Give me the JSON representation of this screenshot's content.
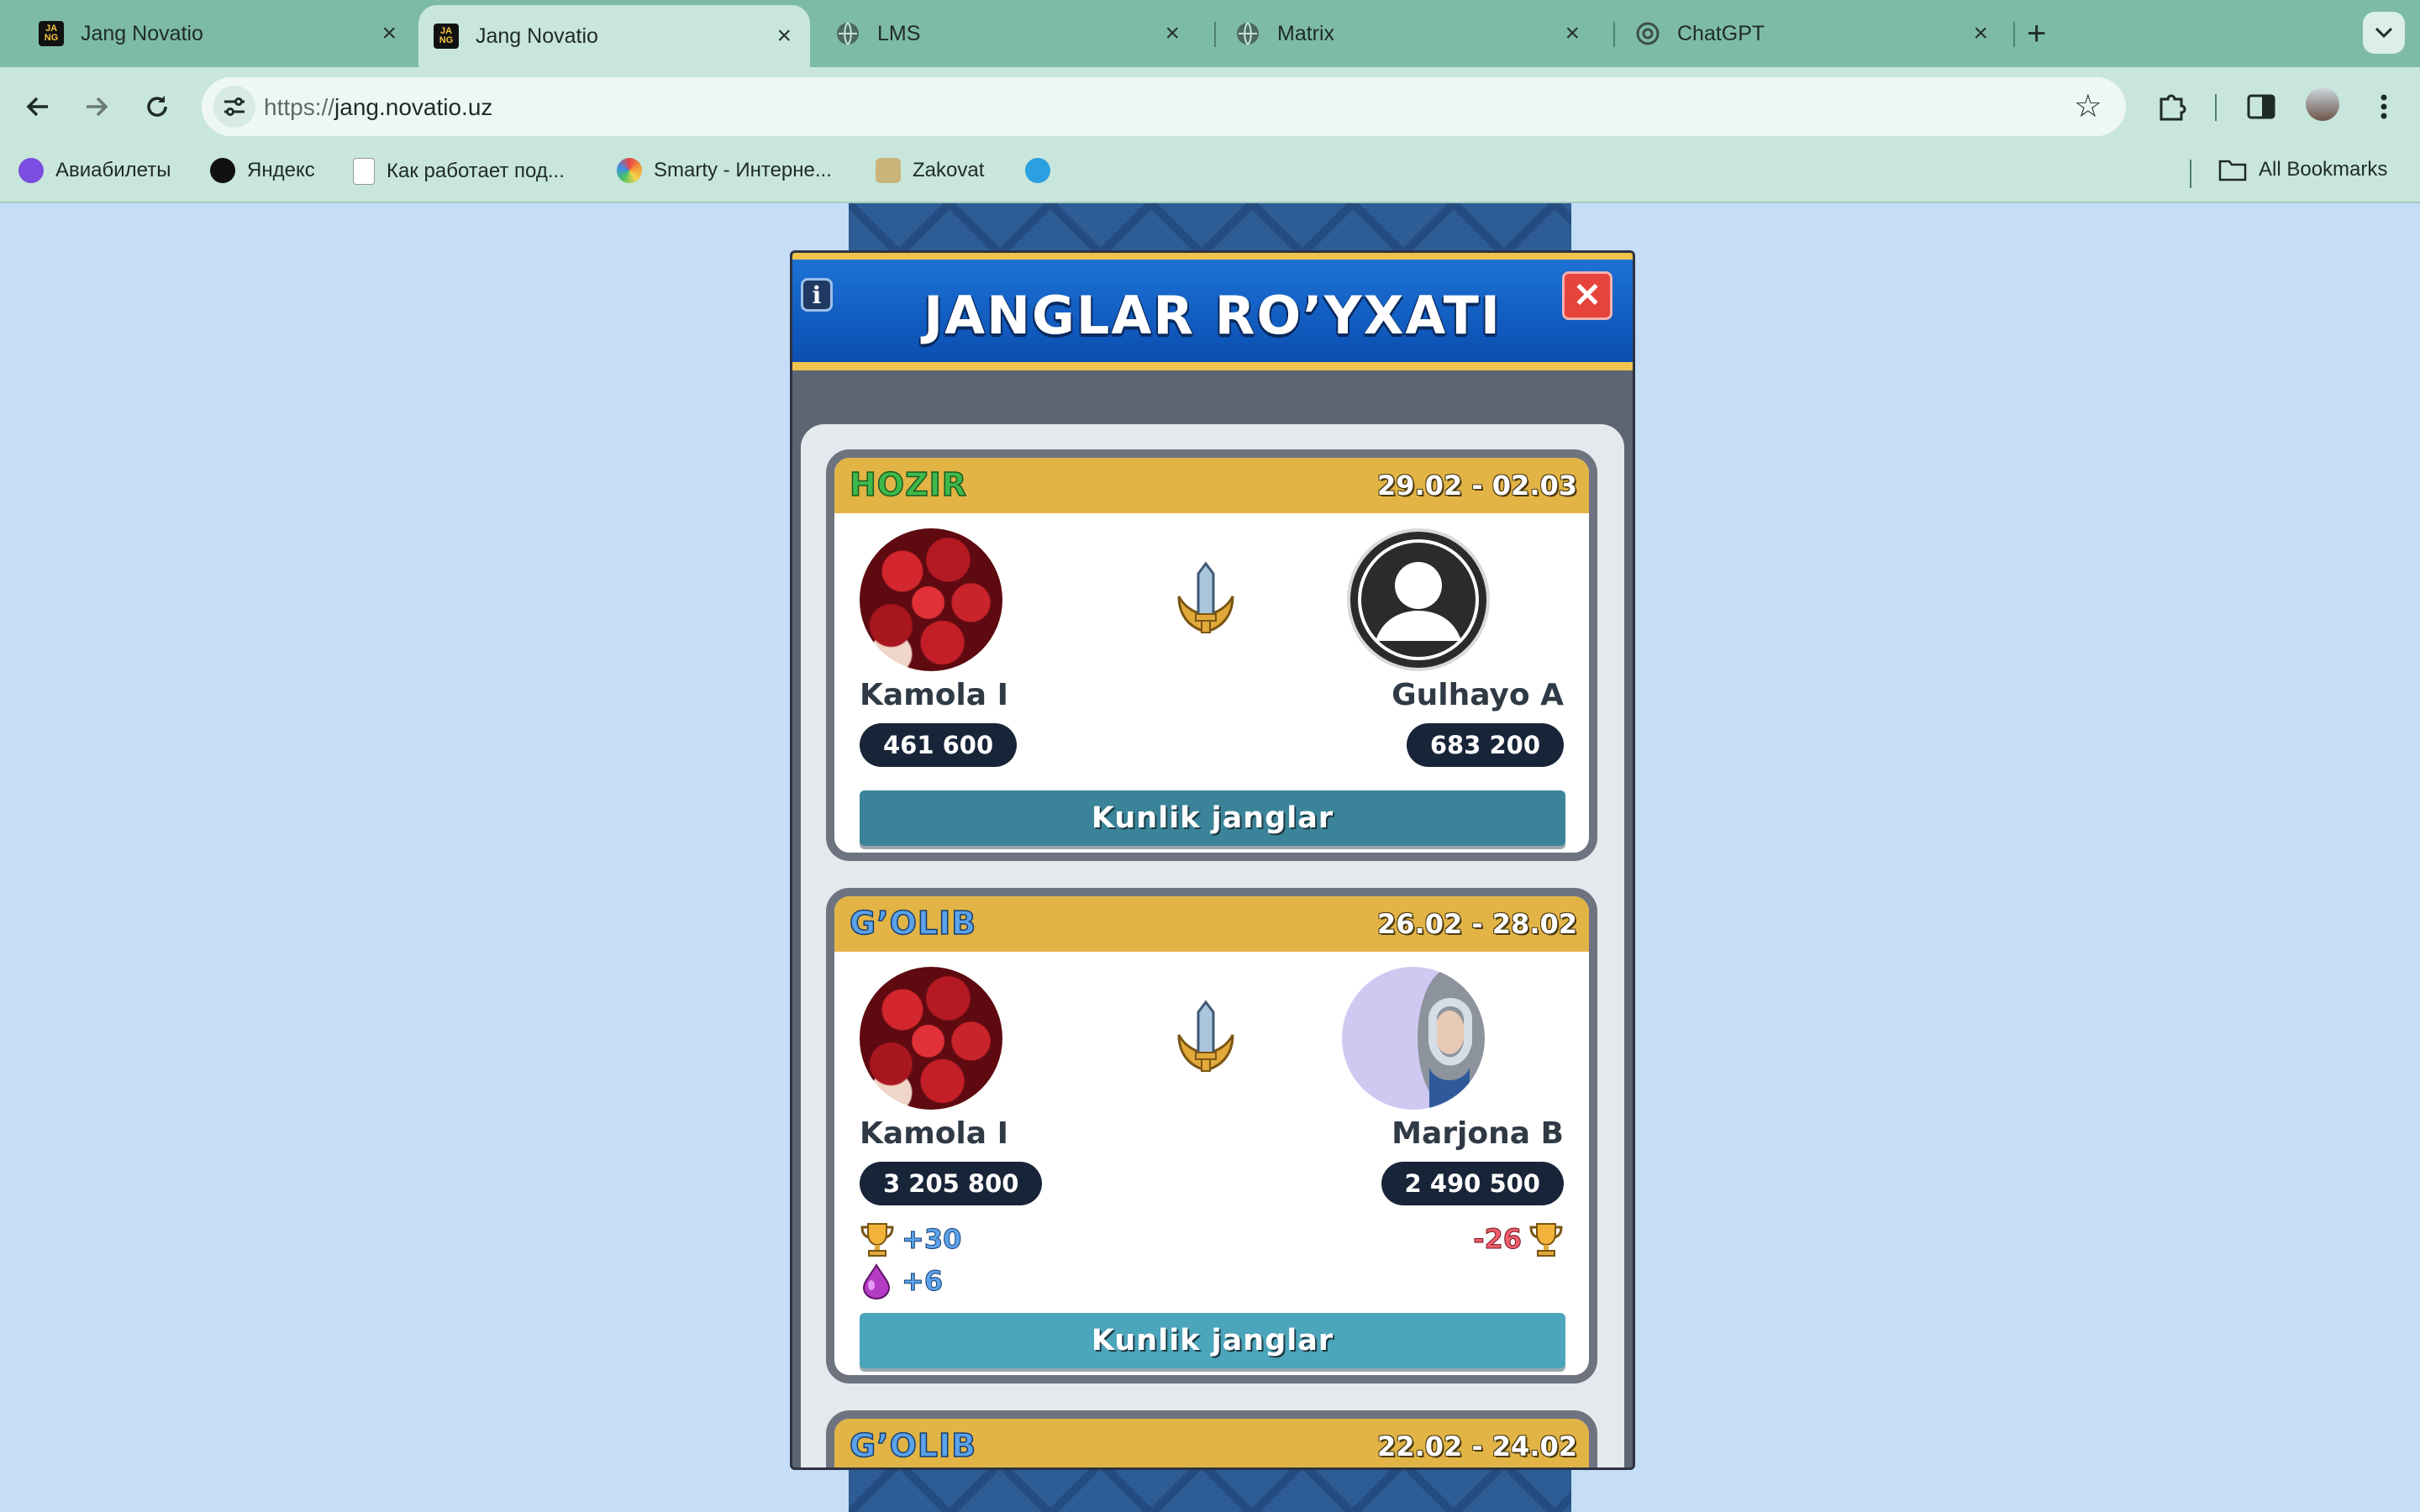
{
  "tabs": [
    {
      "title": "Jang Novatio",
      "favicon": "jn-logo",
      "active": false
    },
    {
      "title": "Jang Novatio",
      "favicon": "jn-logo",
      "active": true
    },
    {
      "title": "LMS",
      "favicon": "globe-icon",
      "active": false
    },
    {
      "title": "Matrix",
      "favicon": "globe-icon",
      "active": false
    },
    {
      "title": "ChatGPT",
      "favicon": "chatgpt-icon",
      "active": false
    }
  ],
  "favicon_text": "JA\nNG",
  "tab_close_glyph": "×",
  "new_tab_glyph": "+",
  "omnibox": {
    "scheme": "https://",
    "host": "jang.novatio.uz"
  },
  "bookmarks": [
    {
      "label": "Авиабилеты",
      "icon": "plane-icon",
      "color": "#7b4de0"
    },
    {
      "label": "Яндекс",
      "icon": "yandex-icon",
      "color": "#111111"
    },
    {
      "label": "Как работает под...",
      "icon": "doc-icon",
      "color": "#ffffff"
    },
    {
      "label": "Smarty - Интерне...",
      "icon": "rainbow-icon",
      "color": "#f29b38"
    },
    {
      "label": "Zakovat",
      "icon": "zakovat-icon",
      "color": "#c9b57a"
    },
    {
      "label": "",
      "icon": "telegram-icon",
      "color": "#2aa0e0"
    }
  ],
  "all_bookmarks_label": "All Bookmarks",
  "modal": {
    "title": "JANGLAR RO’YXATI",
    "info_glyph": "i",
    "close_glyph": "✕"
  },
  "battles": [
    {
      "status": "HOZIR",
      "dates": "29.02 - 02.03",
      "left": {
        "name": "Kamola I",
        "score": "461 600",
        "avatar": "roses"
      },
      "right": {
        "name": "Gulhayo A",
        "score": "683 200",
        "avatar": "default"
      },
      "button": "Kunlik janglar"
    },
    {
      "status": "G’OLIB",
      "dates": "26.02 - 28.02",
      "left": {
        "name": "Kamola I",
        "score": "3 205 800",
        "avatar": "roses",
        "trophy_delta": "+30",
        "elixir_delta": "+6"
      },
      "right": {
        "name": "Marjona B",
        "score": "2 490 500",
        "avatar": "photo",
        "trophy_delta": "-26"
      },
      "button": "Kunlik janglar"
    },
    {
      "status": "G’OLIB",
      "dates": "22.02 - 24.02"
    }
  ],
  "colors": {
    "header_blue": "#0b4eb1",
    "header_gold": "#f0c34d",
    "card_gold": "#e2b446",
    "score_pill": "#182538"
  }
}
